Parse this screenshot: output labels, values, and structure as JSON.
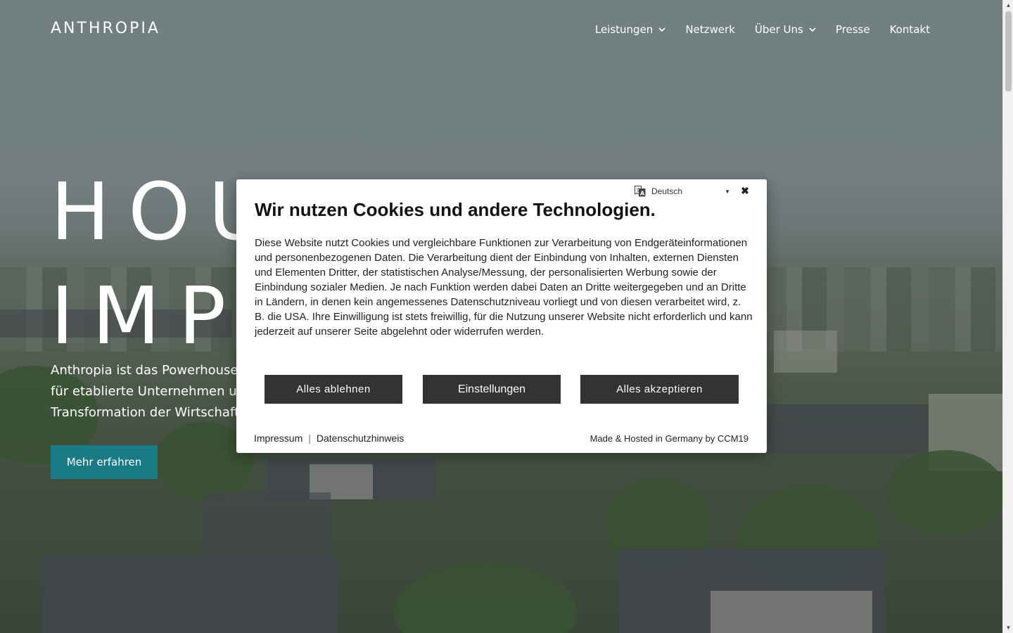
{
  "brand": {
    "logo_text": "ANTHROPIA"
  },
  "nav": {
    "items": [
      {
        "label": "Leistungen",
        "has_dropdown": true
      },
      {
        "label": "Netzwerk",
        "has_dropdown": false
      },
      {
        "label": "Über Uns",
        "has_dropdown": true
      },
      {
        "label": "Presse",
        "has_dropdown": false
      },
      {
        "label": "Kontakt",
        "has_dropdown": false
      }
    ]
  },
  "hero": {
    "title_line1": "HOUSE OF",
    "title_line2": "IMPACT",
    "subtitle_line1": "Anthropia ist das Powerhouse f",
    "subtitle_line2": "für etablierte Unternehmen und",
    "subtitle_line3": "Transformation der Wirtschaft",
    "cta_label": "Mehr erfahren",
    "cta_color": "#1a7a86"
  },
  "cookie_dialog": {
    "language_icon": "translate-icon",
    "language": "Deutsch",
    "close_icon": "close-icon",
    "title": "Wir nutzen Cookies und andere Technologien.",
    "body": "Diese Website nutzt Cookies und vergleichbare Funktionen zur Verarbeitung von Endgeräteinformationen und personenbezogenen Daten. Die Verarbeitung dient der Einbindung von Inhalten, externen Diensten und Elementen Dritter, der statistischen Analyse/Messung, der personalisierten Werbung sowie der Einbindung sozialer Medien. Je nach Funktion werden dabei Daten an Dritte weitergegeben und an Dritte in Ländern, in denen kein angemessenes Datenschutzniveau vorliegt und von diesen verarbeitet wird, z. B. die USA. Ihre Einwilligung ist stets freiwillig, für die Nutzung unserer Website nicht erforderlich und kann jederzeit auf unserer Seite abgelehnt oder widerrufen werden.",
    "buttons": {
      "reject": "Alles ablehnen",
      "settings": "Einstellungen",
      "accept": "Alles akzeptieren"
    },
    "links": {
      "imprint": "Impressum",
      "separator": "|",
      "privacy": "Datenschutzhinweis"
    },
    "credit": "Made & Hosted in Germany by CCM19",
    "button_color": "#333333"
  }
}
